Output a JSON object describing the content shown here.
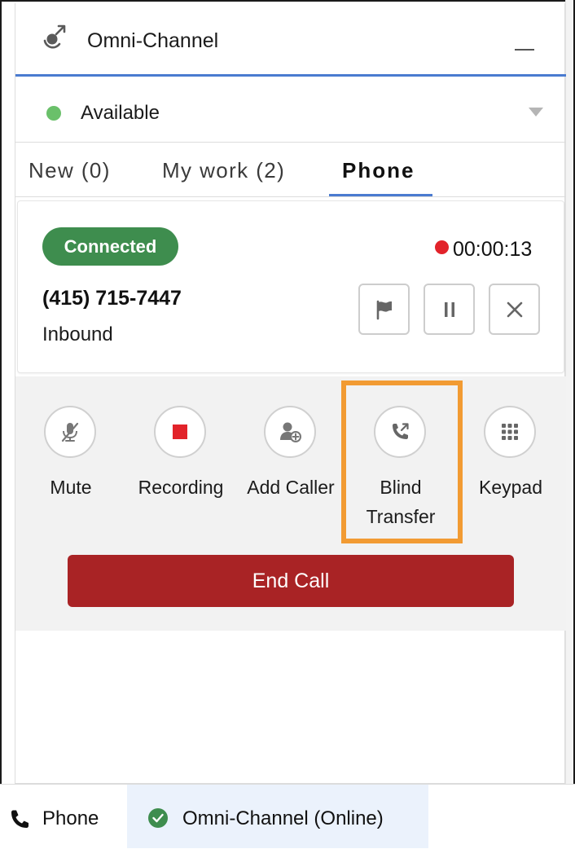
{
  "header": {
    "title": "Omni-Channel",
    "icon": "omni-channel-icon"
  },
  "status": {
    "label": "Available",
    "color": "#6ac06a"
  },
  "tabs": [
    {
      "label": "New (0)",
      "active": false
    },
    {
      "label": "My work (2)",
      "active": false
    },
    {
      "label": "Phone",
      "active": true
    }
  ],
  "call": {
    "state": "Connected",
    "timer": "00:00:13",
    "number": "(415) 715-7447",
    "direction": "Inbound",
    "actions": [
      "flag-icon",
      "pause-icon",
      "close-icon"
    ]
  },
  "controls": [
    {
      "label": "Mute",
      "icon": "mute-icon"
    },
    {
      "label": "Recording",
      "icon": "stop-recording-icon"
    },
    {
      "label": "Add Caller",
      "icon": "add-caller-icon"
    },
    {
      "label": "Blind Transfer",
      "label_line1": "Blind",
      "label_line2": "Transfer",
      "icon": "blind-transfer-icon",
      "highlighted": true
    },
    {
      "label": "Keypad",
      "icon": "keypad-icon"
    }
  ],
  "end_call_label": "End Call",
  "footer": {
    "phone_label": "Phone",
    "omni_label": "Omni-Channel (Online)"
  },
  "colors": {
    "accent": "#4a7bd0",
    "connected": "#3e8d4e",
    "end_call": "#a92325",
    "highlight": "#f29b33",
    "recording": "#e2232a"
  }
}
